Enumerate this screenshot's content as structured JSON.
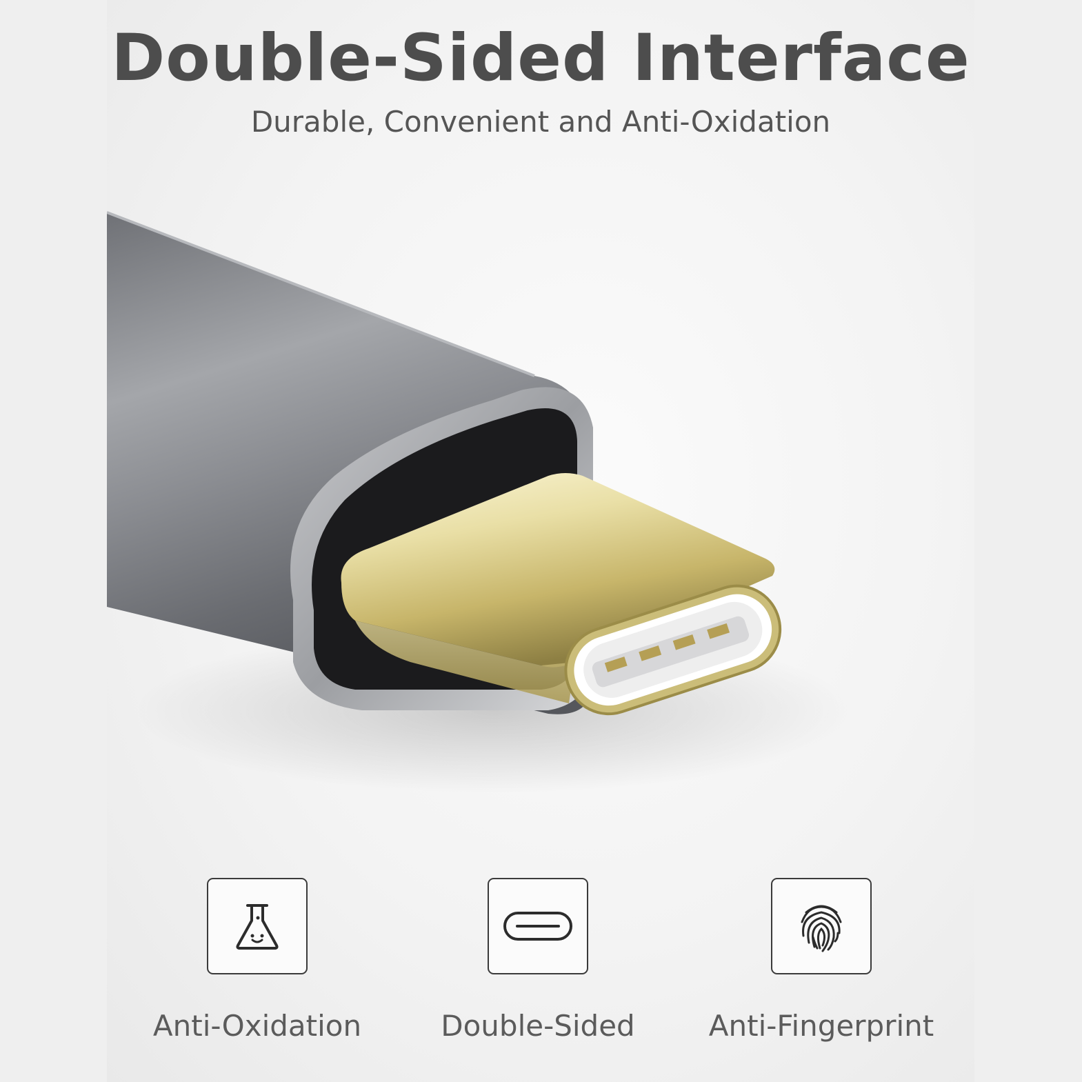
{
  "header": {
    "title": "Double-Sided Interface",
    "subtitle": "Durable, Convenient and Anti-Oxidation"
  },
  "features": [
    {
      "icon": "flask-icon",
      "label": "Anti-Oxidation"
    },
    {
      "icon": "usb-c-port-icon",
      "label": "Double-Sided"
    },
    {
      "icon": "fingerprint-icon",
      "label": "Anti-Fingerprint"
    }
  ],
  "colors": {
    "text_dark": "#4d4d4d",
    "text_sub": "#555555",
    "connector_gold": "#d8cc8a",
    "housing_gray": "#8a8c91"
  }
}
